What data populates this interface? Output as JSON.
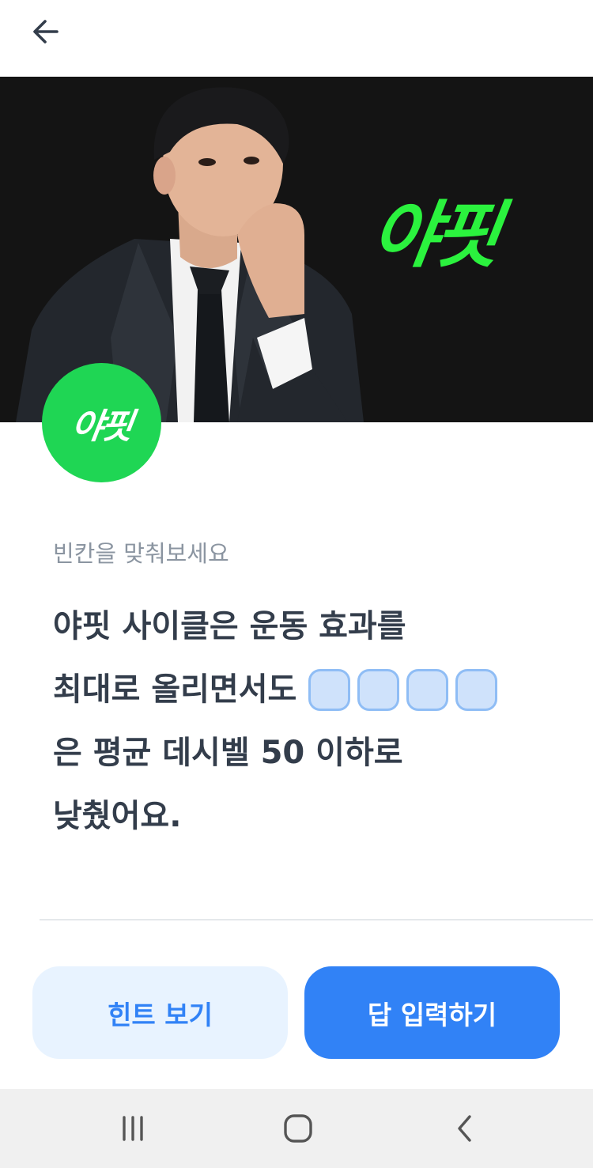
{
  "header": {
    "back_icon": "arrow-left-icon"
  },
  "banner": {
    "logo_text": "야핏",
    "background": "#141414",
    "accent": "#2bf23e"
  },
  "profile": {
    "logo_text": "야핏",
    "color": "#1fd654"
  },
  "quiz": {
    "prompt": "빈칸을 맞춰보세요",
    "line1": "야핏 사이클은 운동 효과를",
    "line2": "최대로 올리면서도",
    "blank_count": 4,
    "line3": "은 평균 데시벨 50 이하로",
    "line4": "낮췄어요."
  },
  "actions": {
    "hint_label": "힌트 보기",
    "answer_label": "답 입력하기",
    "primary_color": "#3182f6",
    "secondary_color": "#e8f3ff"
  },
  "system_nav": {
    "recent_icon": "recent-apps-icon",
    "home_icon": "home-icon",
    "back_icon": "back-chevron-icon"
  }
}
